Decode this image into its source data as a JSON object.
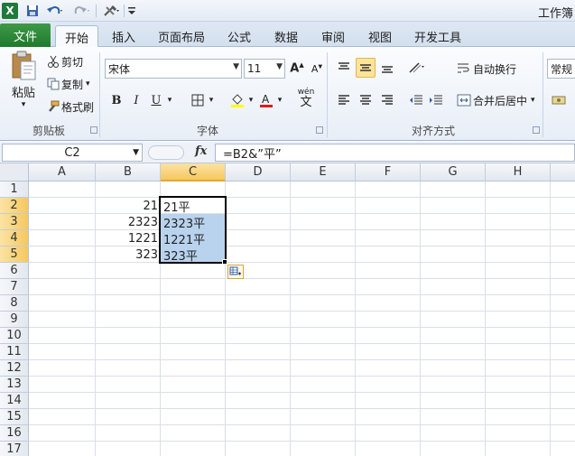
{
  "window": {
    "title": "工作簿"
  },
  "quick_access": {
    "icons": [
      "excel-logo",
      "save-icon",
      "undo-icon",
      "redo-icon",
      "tools-icon",
      "customize-icon"
    ]
  },
  "tabs": [
    {
      "label": "文件"
    },
    {
      "label": "开始"
    },
    {
      "label": "插入"
    },
    {
      "label": "页面布局"
    },
    {
      "label": "公式"
    },
    {
      "label": "数据"
    },
    {
      "label": "审阅"
    },
    {
      "label": "视图"
    },
    {
      "label": "开发工具"
    }
  ],
  "ribbon": {
    "clipboard": {
      "label": "剪贴板",
      "paste": "粘贴",
      "cut": "剪切",
      "copy": "复制",
      "format_painter": "格式刷"
    },
    "font": {
      "label": "字体",
      "name": "宋体",
      "size": "11",
      "bold": "B",
      "italic": "I",
      "underline": "U",
      "phonetic": "wén"
    },
    "alignment": {
      "label": "对齐方式",
      "wrap": "自动换行",
      "merge": "合并后居中"
    },
    "number": {
      "format": "常规"
    }
  },
  "formula_bar": {
    "name_box": "C2",
    "fx": "fx",
    "formula": "=B2&”平”"
  },
  "columns": [
    "A",
    "B",
    "C",
    "D",
    "E",
    "F",
    "G",
    "H"
  ],
  "rows": [
    "1",
    "2",
    "3",
    "4",
    "5",
    "6",
    "7",
    "8",
    "9",
    "10",
    "11",
    "12",
    "13",
    "14",
    "15",
    "16",
    "17"
  ],
  "cells": {
    "B2": "21",
    "B3": "2323",
    "B4": "1221",
    "B5": "323",
    "C2": "21平",
    "C3": "2323平",
    "C4": "1221平",
    "C5": "323平"
  },
  "colors": {
    "file_tab": "#2a8a37",
    "selection": "#b9d3ee",
    "header_active": "#f6c85f"
  }
}
